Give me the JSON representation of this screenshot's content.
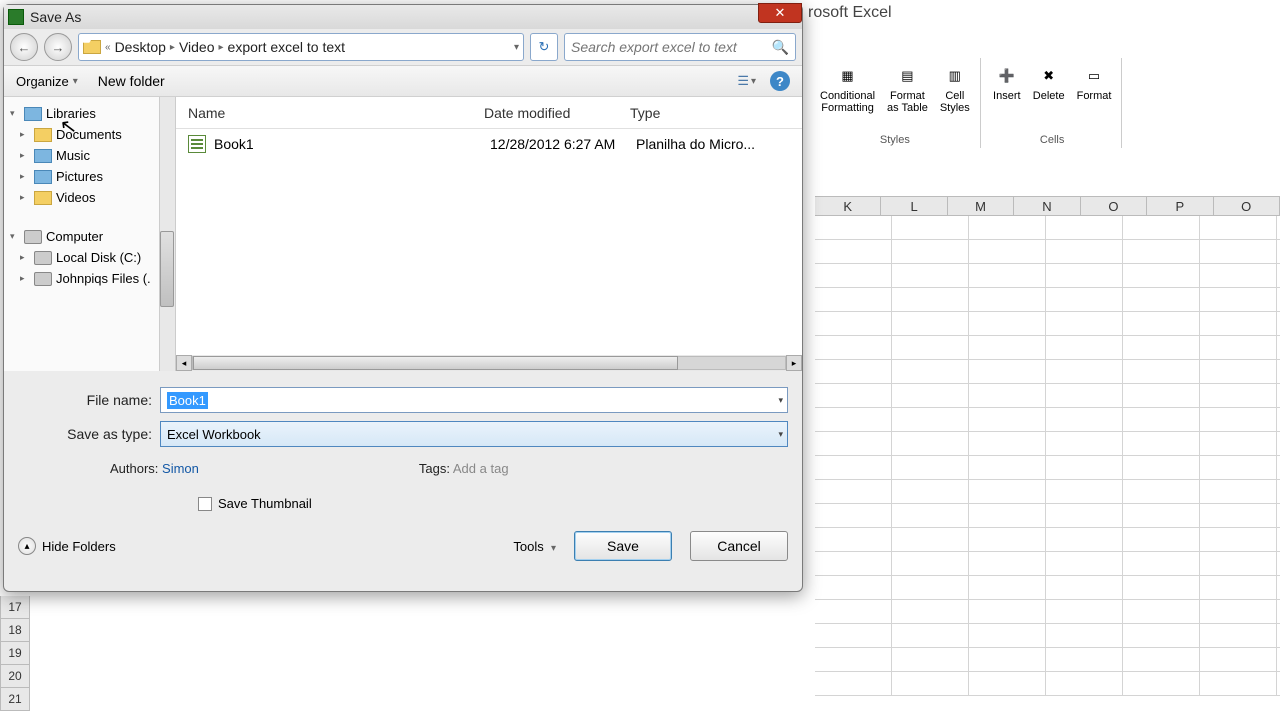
{
  "excel": {
    "title": "rosoft Excel",
    "groups": {
      "styles": {
        "cond": "Conditional\nFormatting",
        "table": "Format\nas Table",
        "cell": "Cell\nStyles",
        "label": "Styles"
      },
      "cells": {
        "insert": "Insert",
        "delete": "Delete",
        "format": "Format",
        "label": "Cells"
      }
    },
    "cols": [
      "K",
      "L",
      "M",
      "N",
      "O",
      "P",
      "O"
    ],
    "rows": [
      "17",
      "18",
      "19",
      "20",
      "21"
    ]
  },
  "dialog": {
    "title": "Save As",
    "breadcrumb": {
      "back": "«",
      "seg1": "Desktop",
      "seg2": "Video",
      "seg3": "export excel to text"
    },
    "search_placeholder": "Search export excel to text",
    "toolbar": {
      "organize": "Organize",
      "newfolder": "New folder"
    },
    "tree": {
      "libraries": "Libraries",
      "documents": "Documents",
      "music": "Music",
      "pictures": "Pictures",
      "videos": "Videos",
      "computer": "Computer",
      "localdisk": "Local Disk (C:)",
      "johnpiqs": "Johnpiqs Files (."
    },
    "list": {
      "col_name": "Name",
      "col_date": "Date modified",
      "col_type": "Type",
      "file_name": "Book1",
      "file_date": "12/28/2012 6:27 AM",
      "file_type": "Planilha do Micro..."
    },
    "form": {
      "filename_lbl": "File name:",
      "filename_val": "Book1",
      "type_lbl": "Save as type:",
      "type_val": "Excel Workbook",
      "authors_lbl": "Authors:",
      "authors_val": "Simon",
      "tags_lbl": "Tags:",
      "tags_val": "Add a tag",
      "thumb": "Save Thumbnail"
    },
    "footer": {
      "hide": "Hide Folders",
      "tools": "Tools",
      "save": "Save",
      "cancel": "Cancel"
    }
  }
}
